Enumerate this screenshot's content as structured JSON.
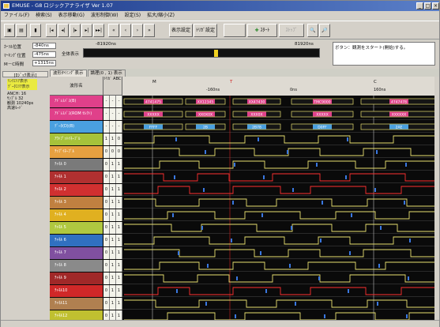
{
  "window": {
    "title": "EMUSE - G8 ロジックアナライザ Ver 1.07"
  },
  "menu": [
    "ファイル(F)",
    "検索(S)",
    "表示移動(G)",
    "波形制御(W)",
    "設定(S)",
    "拡大/縮小(Z)"
  ],
  "toolbar": {
    "display_settings": "表示設定",
    "trigger_settings": "ﾄﾘｶﾞ設定",
    "start": "ｽﾀｰﾄ",
    "stop": "ｽﾄｯﾌﾟ",
    "zoom_in": "+",
    "zoom_out": "−"
  },
  "info": {
    "cursor_pos_label": "ｶｰｿﾙ位置",
    "cursor_pos_value": "-840ns",
    "marking_pos_label": "ﾏｰｷﾝｸﾞ位置",
    "marking_pos_value": "-475ns",
    "mc_label": "M－C時間",
    "mc_value": "+1315ns",
    "overview_start": "-81920ns",
    "overview_end": "81920ns",
    "overview_caption": "全体表示"
  },
  "status": {
    "text": "ボタン：観測をスタート(開始)する。"
  },
  "left": {
    "group_label": "[ﾛｼﾞｯｸ表示]",
    "selected_line1": "ﾘﾝｸｴﾘｱ表示",
    "selected_line2": "ﾃﾞｰﾀｴﾘｱ表示",
    "info1": "ANCH: 16",
    "info2": "ｻﾝﾌﾟﾙ 32",
    "info3": "観測 10240ps",
    "info4": "高速ﾓｰﾄﾞ"
  },
  "tabs": [
    "波形ﾀｲﾐﾝｸﾞ表示",
    "論理(0 , 1) 表示"
  ],
  "grid": {
    "name_header": "波形名",
    "col_header": "ﾄﾘｶﾞ ABC",
    "marker_m": "M",
    "marker_t": "T",
    "marker_c": "C",
    "ruler_labels": [
      "-160ns",
      "0ns",
      "160ns"
    ]
  },
  "channels": [
    {
      "name": "ｱﾄﾞﾚｽﾊﾞｽ(B)",
      "color": "#e0408a",
      "flags": [
        "-",
        "-",
        "-"
      ],
      "type": "bus",
      "labels": [
        "4741475",
        "XX12345",
        "XX47430",
        "TMC9000",
        "4747478"
      ]
    },
    {
      "name": "ｱﾄﾞﾚｽﾊﾞｽ(ROM ｾﾚｸﾄ)",
      "color": "#e0408a",
      "flags": [
        "-",
        "-",
        "-"
      ],
      "type": "bus",
      "labels": [
        "XXXXX",
        "XX0X0X",
        "XXX0X",
        "XXXXX",
        "XXXXXX"
      ]
    },
    {
      "name": "ﾃﾞｰﾀ(D)(B)",
      "color": "#4aa0e0",
      "flags": [
        "-",
        "-",
        "-"
      ],
      "type": "bus",
      "labels": [
        "FFFF",
        "2B",
        "2B78",
        "D0FF",
        "2AE"
      ]
    },
    {
      "name": "ｱｳﾄﾌﾟｯﾄｲﾈｰﾌﾞﾙ",
      "color": "#a6c23a",
      "flags": [
        "1",
        "1",
        "0"
      ],
      "type": "digital"
    },
    {
      "name": "ﾁｯﾌﾟｲﾈｰﾌﾞﾙ",
      "color": "#e6a040",
      "flags": [
        "0",
        "0",
        "0"
      ],
      "type": "digital"
    },
    {
      "name": "ﾁｬﾈﾙ 0",
      "color": "#7a7a7a",
      "flags": [
        "0",
        "1",
        "1"
      ],
      "type": "digital"
    },
    {
      "name": "ﾁｬﾈﾙ 1",
      "color": "#b03030",
      "flags": [
        "0",
        "1",
        "1"
      ],
      "type": "digital"
    },
    {
      "name": "ﾁｬﾈﾙ 2",
      "color": "#d03030",
      "flags": [
        "0",
        "1",
        "1"
      ],
      "type": "digital"
    },
    {
      "name": "ﾁｬﾈﾙ 3",
      "color": "#c08040",
      "flags": [
        "0",
        "1",
        "1"
      ],
      "type": "digital"
    },
    {
      "name": "ﾁｬﾈﾙ 4",
      "color": "#e0b020",
      "flags": [
        "0",
        "1",
        "1"
      ],
      "type": "digital"
    },
    {
      "name": "ﾁｬﾈﾙ 5",
      "color": "#b0c840",
      "flags": [
        "0",
        "1",
        "1"
      ],
      "type": "digital"
    },
    {
      "name": "ﾁｬﾈﾙ 6",
      "color": "#3070c0",
      "flags": [
        "0",
        "1",
        "1"
      ],
      "type": "digital"
    },
    {
      "name": "ﾁｬﾈﾙ 7",
      "color": "#8050a0",
      "flags": [
        "0",
        "1",
        "1"
      ],
      "type": "digital"
    },
    {
      "name": "ﾁｬﾈﾙ 8",
      "color": "#8a8a8a",
      "flags": [
        "0",
        "1",
        "1"
      ],
      "type": "digital"
    },
    {
      "name": "ﾁｬﾈﾙ 9",
      "color": "#a02828",
      "flags": [
        "0",
        "1",
        "1"
      ],
      "type": "digital"
    },
    {
      "name": "ﾁｬﾈﾙ10",
      "color": "#d02828",
      "flags": [
        "0",
        "1",
        "1"
      ],
      "type": "digital"
    },
    {
      "name": "ﾁｬﾈﾙ11",
      "color": "#b08050",
      "flags": [
        "0",
        "1",
        "1"
      ],
      "type": "digital"
    },
    {
      "name": "ﾁｬﾈﾙ12",
      "color": "#c0c030",
      "flags": [
        "0",
        "1",
        "1"
      ],
      "type": "digital"
    }
  ]
}
